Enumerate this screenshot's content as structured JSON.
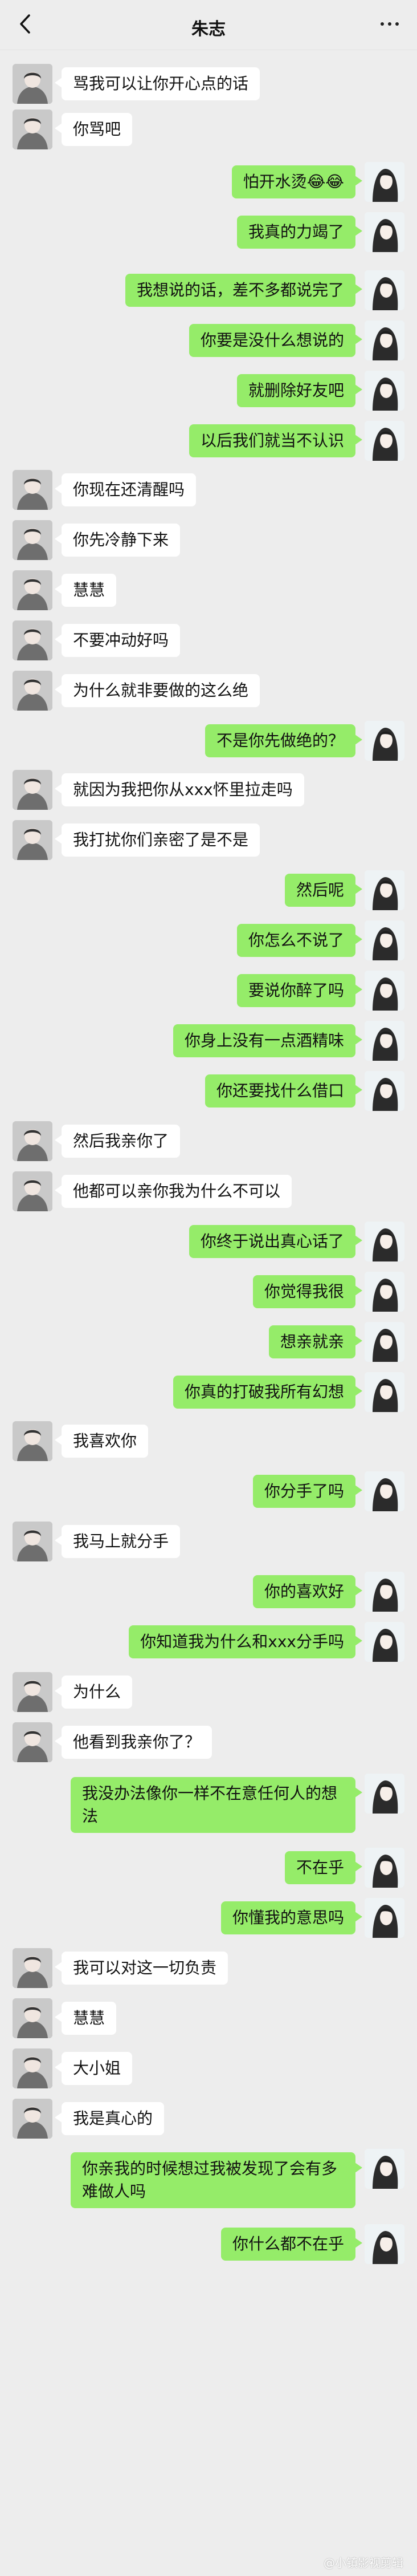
{
  "header": {
    "title": "朱志"
  },
  "messages": [
    {
      "side": "in",
      "text": "骂我可以让你开心点的话"
    },
    {
      "side": "in",
      "text": "你骂吧"
    },
    {
      "side": "out",
      "text": "怕开水烫😂😂"
    },
    {
      "side": "out",
      "text": "我真的力竭了"
    },
    {
      "side": "out",
      "text": "我想说的话，差不多都说完了"
    },
    {
      "side": "out",
      "text": "你要是没什么想说的"
    },
    {
      "side": "out",
      "text": "就删除好友吧"
    },
    {
      "side": "out",
      "text": "以后我们就当不认识"
    },
    {
      "side": "in",
      "text": "你现在还清醒吗"
    },
    {
      "side": "in",
      "text": "你先冷静下来"
    },
    {
      "side": "in",
      "text": "慧慧"
    },
    {
      "side": "in",
      "text": "不要冲动好吗"
    },
    {
      "side": "in",
      "text": "为什么就非要做的这么绝"
    },
    {
      "side": "out",
      "text": "不是你先做绝的？"
    },
    {
      "side": "in",
      "text": "就因为我把你从xxx怀里拉走吗"
    },
    {
      "side": "in",
      "text": "我打扰你们亲密了是不是"
    },
    {
      "side": "out",
      "text": "然后呢"
    },
    {
      "side": "out",
      "text": "你怎么不说了"
    },
    {
      "side": "out",
      "text": "要说你醉了吗"
    },
    {
      "side": "out",
      "text": "你身上没有一点酒精味"
    },
    {
      "side": "out",
      "text": "你还要找什么借口"
    },
    {
      "side": "in",
      "text": "然后我亲你了"
    },
    {
      "side": "in",
      "text": "他都可以亲你我为什么不可以"
    },
    {
      "side": "out",
      "text": "你终于说出真心话了"
    },
    {
      "side": "out",
      "text": "你觉得我很"
    },
    {
      "side": "out",
      "text": "想亲就亲"
    },
    {
      "side": "out",
      "text": "你真的打破我所有幻想"
    },
    {
      "side": "in",
      "text": "我喜欢你"
    },
    {
      "side": "out",
      "text": "你分手了吗"
    },
    {
      "side": "in",
      "text": "我马上就分手"
    },
    {
      "side": "out",
      "text": "你的喜欢好"
    },
    {
      "side": "out",
      "text": "你知道我为什么和xxx分手吗"
    },
    {
      "side": "in",
      "text": "为什么"
    },
    {
      "side": "in",
      "text": "他看到我亲你了？"
    },
    {
      "side": "out",
      "text": "我没办法像你一样不在意任何人的想法"
    },
    {
      "side": "out",
      "text": "不在乎"
    },
    {
      "side": "out",
      "text": "你懂我的意思吗"
    },
    {
      "side": "in",
      "text": "我可以对这一切负责"
    },
    {
      "side": "in",
      "text": "慧慧"
    },
    {
      "side": "in",
      "text": "大小姐"
    },
    {
      "side": "in",
      "text": "我是真心的"
    },
    {
      "side": "out",
      "text": "你亲我的时候想过我被发现了会有多难做人吗"
    },
    {
      "side": "out",
      "text": "你什么都不在乎"
    }
  ],
  "watermark": "@小镇影视剪辑"
}
